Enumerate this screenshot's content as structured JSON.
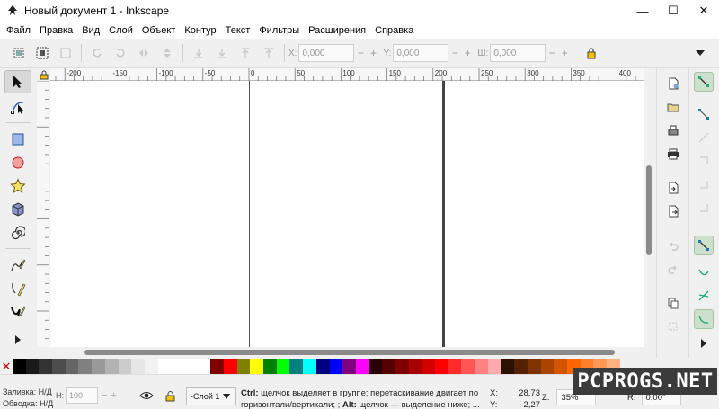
{
  "window": {
    "title": "Новый документ 1 - Inkscape",
    "minimize": "—",
    "maximize": "☐",
    "close": "✕"
  },
  "menu": [
    "Файл",
    "Правка",
    "Вид",
    "Слой",
    "Объект",
    "Контур",
    "Текст",
    "Фильтры",
    "Расширения",
    "Справка"
  ],
  "controls": {
    "x_label": "X:",
    "x_value": "0,000",
    "y_label": "Y:",
    "y_value": "0,000",
    "w_label": "Ш:",
    "w_value": "0,000",
    "minus": "−",
    "plus": "+"
  },
  "ruler": {
    "labels": [
      "-200",
      "-150",
      "-100",
      "-50",
      "0",
      "50",
      "100",
      "150",
      "200",
      "250",
      "300",
      "350",
      "400"
    ]
  },
  "palette": {
    "none_symbol": "✕",
    "colors": [
      "#000000",
      "#1a1a1a",
      "#333333",
      "#4d4d4d",
      "#666666",
      "#808080",
      "#999999",
      "#b3b3b3",
      "#cccccc",
      "#e6e6e6",
      "#f2f2f2",
      "#ffffff",
      "#ffffff",
      "#ffffff",
      "#ffffff",
      "#800000",
      "#ff0000",
      "#808000",
      "#ffff00",
      "#008000",
      "#00ff00",
      "#008080",
      "#00ffff",
      "#000080",
      "#0000ff",
      "#800080",
      "#ff00ff",
      "#2b0000",
      "#550000",
      "#800000",
      "#aa0000",
      "#d40000",
      "#ff0000",
      "#ff2a2a",
      "#ff5555",
      "#ff8080",
      "#ffaaaa",
      "#2b1100",
      "#552200",
      "#803300",
      "#aa4400",
      "#d45500",
      "#ff6600",
      "#ff7f2a",
      "#ff9955",
      "#ffb380"
    ]
  },
  "status": {
    "fill_label": "Заливка:",
    "fill_value": "Н/Д",
    "stroke_label": "Обводка:",
    "stroke_value": "Н/Д",
    "h_label": "H:",
    "h_value": "100",
    "layer": "-Слой 1",
    "message_bold1": "Ctrl:",
    "message_text1": " щелчок выделяет в группе; перетаскивание двигает по горизонтали/вертикали; ;",
    "message_bold2": "Alt:",
    "message_text2": " щелчок — выделение ниже; ...",
    "x_label": "X:",
    "x_value": "28,73",
    "y_label": "Y:",
    "y_value": "2,27",
    "zoom_label": "Z:",
    "zoom_value": "35%",
    "rot_label": "R:",
    "rot_value": "0,00°"
  },
  "watermark": "PCPROGS.NET"
}
